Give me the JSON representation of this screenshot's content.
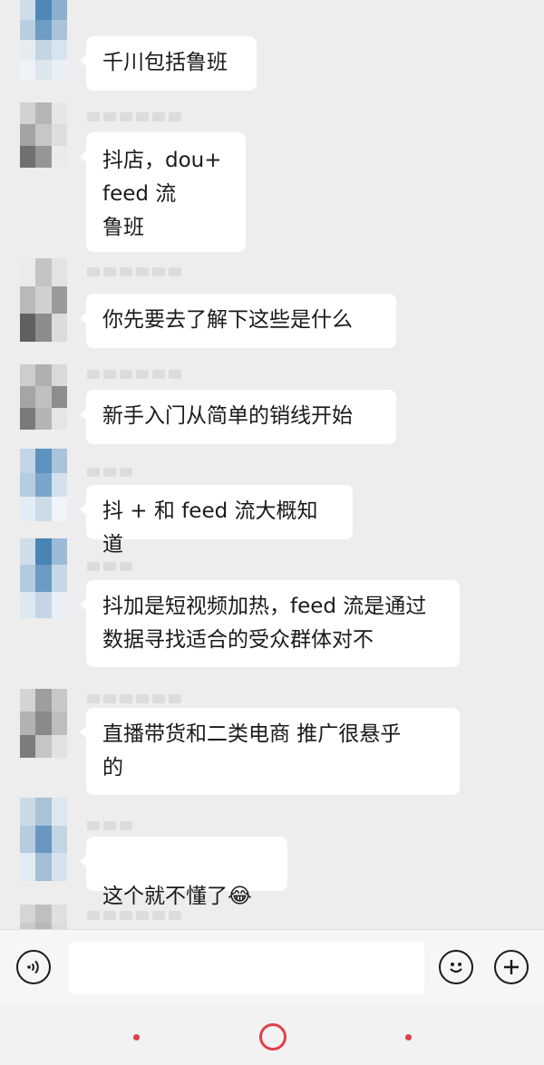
{
  "messages": [
    {
      "text": "千川包括鲁班"
    },
    {
      "text": "抖店，dou+\nfeed 流\n鲁班"
    },
    {
      "text": "你先要去了解下这些是什么"
    },
    {
      "text": "新手入门从简单的销线开始"
    },
    {
      "text": "抖 + 和 feed 流大概知道"
    },
    {
      "text": "抖加是短视频加热，feed 流是通过\n数据寻找适合的受众群体对不"
    },
    {
      "text": "直播带货和二类电商  推广很悬乎\n的"
    },
    {
      "text": "这个就不懂了",
      "emoji": "😂"
    }
  ],
  "input_bar": {
    "voice_icon": "voice-icon",
    "emoji_icon": "smiley-icon",
    "plus_icon": "plus-icon",
    "message_value": ""
  },
  "nav_bar": {
    "menu_icon": "menu-dot-icon",
    "home_icon": "home-circle-icon",
    "back_icon": "back-dot-icon"
  },
  "colors": {
    "background": "#ededed",
    "bubble": "#ffffff",
    "nav_accent": "#e0404a"
  }
}
